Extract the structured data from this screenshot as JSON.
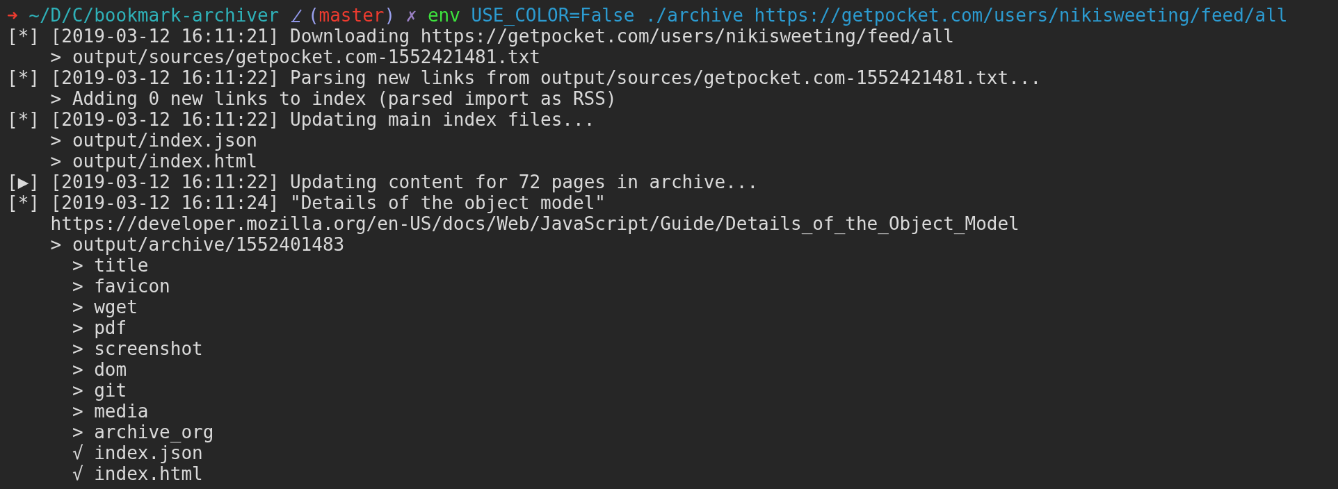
{
  "prompt": {
    "arrow": "➜",
    "cwd": "~/D/C/bookmark-archiver",
    "branch": "(master)",
    "dirty_mark": "✗",
    "command": "env",
    "args": "USE_COLOR=False ./archive https://getpocket.com/users/nikisweeting/feed/all"
  },
  "log": [
    {
      "marker": "[*]",
      "timestamp": "[2019-03-12 16:11:21]",
      "message": "Downloading https://getpocket.com/users/nikisweeting/feed/all",
      "children": [
        {
          "text": "> output/sources/getpocket.com-1552421481.txt"
        }
      ]
    },
    {
      "marker": "[*]",
      "timestamp": "[2019-03-12 16:11:22]",
      "message": "Parsing new links from output/sources/getpocket.com-1552421481.txt...",
      "children": [
        {
          "text": "> Adding 0 new links to index (parsed import as RSS)"
        }
      ]
    },
    {
      "marker": "[*]",
      "timestamp": "[2019-03-12 16:11:22]",
      "message": "Updating main index files...",
      "children": [
        {
          "text": "> output/index.json"
        },
        {
          "text": "> output/index.html"
        }
      ]
    },
    {
      "marker": "[▶]",
      "timestamp": "[2019-03-12 16:11:22]",
      "message": "Updating content for 72 pages in archive..."
    },
    {
      "marker": "[*]",
      "timestamp": "[2019-03-12 16:11:24]",
      "message": "\"Details of the object model\"",
      "children": [
        {
          "text": "https://developer.mozilla.org/en-US/docs/Web/JavaScript/Guide/Details_of_the_Object_Model"
        },
        {
          "text": "> output/archive/1552401483",
          "children": [
            {
              "text": "> title"
            },
            {
              "text": "> favicon"
            },
            {
              "text": "> wget"
            },
            {
              "text": "> pdf"
            },
            {
              "text": "> screenshot"
            },
            {
              "text": "> dom"
            },
            {
              "text": "> git"
            },
            {
              "text": "> media"
            },
            {
              "text": "> archive_org"
            },
            {
              "text": "√ index.json"
            },
            {
              "text": "√ index.html"
            }
          ]
        }
      ]
    }
  ]
}
